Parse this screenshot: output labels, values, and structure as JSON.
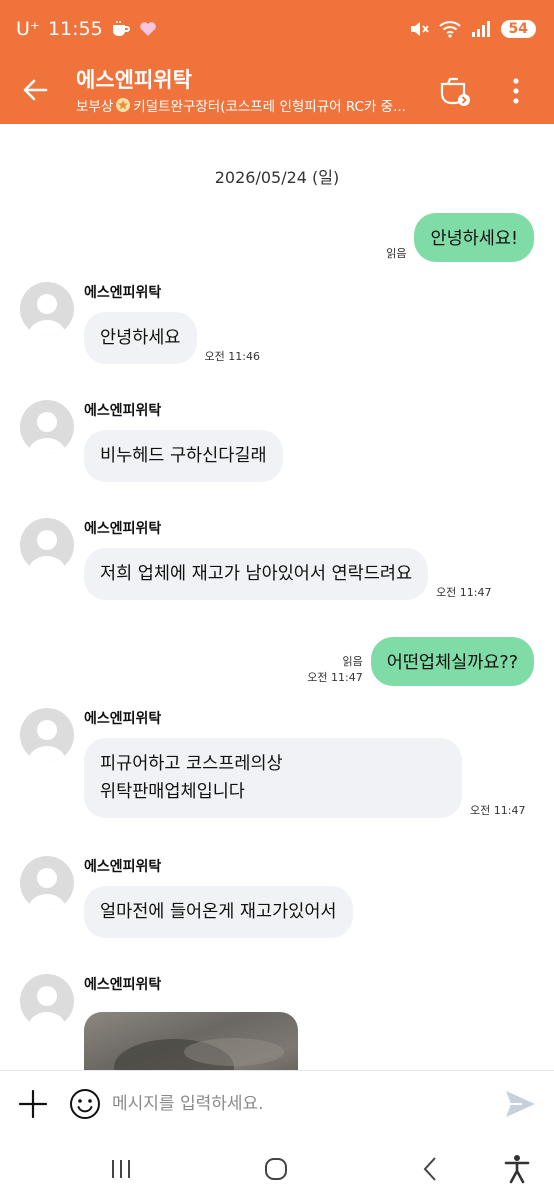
{
  "status_bar": {
    "carrier": "U⁺",
    "time": "11:55",
    "battery": "54"
  },
  "header": {
    "title": "에스엔피위탁",
    "subtitle_prefix": "보부상",
    "subtitle_rest": "키덜트완구장터(코스프레 인형피규어 RC카 중..."
  },
  "chat": {
    "date": "2026/05/24 (일)",
    "messages": [
      {
        "type": "out",
        "text": "안녕하세요!",
        "read": "읽음",
        "time": ""
      },
      {
        "type": "in",
        "sender": "에스엔피위탁",
        "text": "안녕하세요",
        "time": "오전 11:46"
      },
      {
        "type": "in",
        "sender": "에스엔피위탁",
        "text": "비누헤드 구하신다길래",
        "time": ""
      },
      {
        "type": "in",
        "sender": "에스엔피위탁",
        "text": "저희 업체에 재고가 남아있어서 연락드려요",
        "time": "오전 11:47"
      },
      {
        "type": "out",
        "text": "어떤업체실까요??",
        "read": "읽음",
        "time": "오전 11:47"
      },
      {
        "type": "in",
        "sender": "에스엔피위탁",
        "text": "피규어하고 코스프레의상\n위탁판매업체입니다",
        "time": "오전 11:47"
      },
      {
        "type": "in",
        "sender": "에스엔피위탁",
        "text": "얼마전에 들어온게 재고가있어서",
        "time": ""
      },
      {
        "type": "in",
        "sender": "에스엔피위탁",
        "text": "",
        "time": ""
      }
    ]
  },
  "input": {
    "placeholder": "메시지를 입력하세요."
  },
  "icons": {
    "back": "arrow-left-icon",
    "cup": "coffee-cup-icon",
    "more": "more-vertical-icon",
    "plus": "plus-icon",
    "emoji": "smiley-icon",
    "send": "send-icon"
  },
  "colors": {
    "brand": "#f0733c",
    "outgoing_bubble": "#7fdca6",
    "incoming_bubble": "#f1f2f6"
  }
}
